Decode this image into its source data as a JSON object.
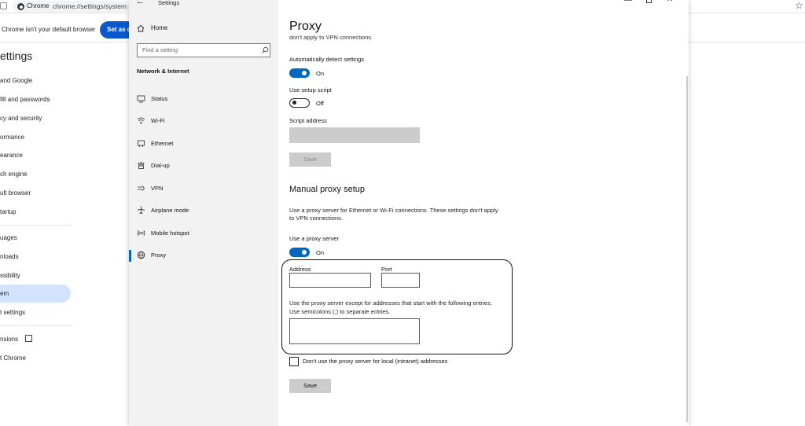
{
  "chrome": {
    "tab_label": "Chrome",
    "url": "chrome://settings/system",
    "infobar_text": "Chrome isn't your default browser",
    "set_default_button": "Set as d",
    "settings_title": "ettings",
    "nav": [
      {
        "label": "and Google"
      },
      {
        "label": "fill and passwords"
      },
      {
        "label": "cy and security"
      },
      {
        "label": "ormance"
      },
      {
        "label": "earance"
      },
      {
        "label": "ch engine"
      },
      {
        "label": "ult browser"
      },
      {
        "label": "tartup"
      },
      {
        "label": "uages"
      },
      {
        "label": "nloads"
      },
      {
        "label": "ssibility"
      },
      {
        "label": "em"
      },
      {
        "label": "t settings"
      },
      {
        "label": "nsions"
      },
      {
        "label": "t Chrome"
      }
    ]
  },
  "window": {
    "title": "Settings",
    "minimize_glyph": "—",
    "close_glyph": "✕"
  },
  "sidebar": {
    "home_label": "Home",
    "search_placeholder": "Find a setting",
    "section_heading": "Network & Internet",
    "items": [
      {
        "label": "Status",
        "icon": "status-icon"
      },
      {
        "label": "Wi-Fi",
        "icon": "wifi-icon"
      },
      {
        "label": "Ethernet",
        "icon": "ethernet-icon"
      },
      {
        "label": "Dial-up",
        "icon": "dialup-icon"
      },
      {
        "label": "VPN",
        "icon": "vpn-icon"
      },
      {
        "label": "Airplane mode",
        "icon": "airplane-icon"
      },
      {
        "label": "Mobile hotspot",
        "icon": "hotspot-icon"
      },
      {
        "label": "Proxy",
        "icon": "proxy-icon",
        "active": true
      }
    ]
  },
  "content": {
    "page_title": "Proxy",
    "clipped_text": "don't apply to VPN connections.",
    "auto_detect": {
      "label": "Automatically detect settings",
      "state": "On"
    },
    "setup_script": {
      "label": "Use setup script",
      "state": "Off"
    },
    "script_address_label": "Script address",
    "script_save_button": "Save",
    "manual_heading": "Manual proxy setup",
    "manual_description": "Use a proxy server for Ethernet or Wi-Fi connections. These settings don't apply to VPN connections.",
    "use_proxy": {
      "label": "Use a proxy server",
      "state": "On"
    },
    "address_label": "Address",
    "address_value": "",
    "port_label": "Port",
    "port_value": "",
    "exceptions_description": "Use the proxy server except for addresses that start with the following entries. Use semicolons (;) to separate entries.",
    "exceptions_value": "",
    "local_bypass_label": "Don't use the proxy server for local (intranet) addresses",
    "local_bypass_checked": false,
    "save_button": "Save"
  },
  "colors": {
    "accent": "#0067c0",
    "chrome_button": "#0b57d0",
    "sidebar_bg": "#f2f2f2",
    "highlight_border": "#111111"
  }
}
